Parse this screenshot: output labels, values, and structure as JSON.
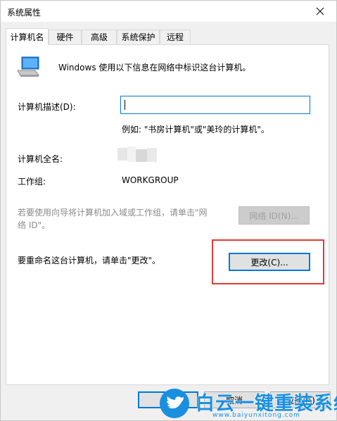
{
  "window": {
    "title": "系统属性"
  },
  "tabs": [
    "计算机名",
    "硬件",
    "高级",
    "系统保护",
    "远程"
  ],
  "description": "Windows 使用以下信息在网络中标识这台计算机。",
  "fields": {
    "description_label": "计算机描述(D):",
    "description_value": "",
    "example": "例如: \"书房计算机\"或\"美玲的计算机\"。",
    "fullname_label": "计算机全名:",
    "workgroup_label": "工作组:",
    "workgroup_value": "WORKGROUP"
  },
  "network": {
    "text_line1": "若要使用向导将计算机加入域或工作组，请单击\"网",
    "text_line2": "络 ID\"。",
    "button": "网络 ID(N)..."
  },
  "rename": {
    "text": "要重命名这台计算机，请单击\"更改\"。",
    "button": "更改(C)..."
  },
  "footer": {
    "cancel": "取消",
    "apply": "应用(A)"
  },
  "watermark": {
    "text": "白云一键重装系统",
    "url": "www.baiyunxitong.com"
  },
  "colors": {
    "accent": "#0078d7",
    "highlight": "#e53935",
    "watermark_blue": "#1a8fe0"
  }
}
